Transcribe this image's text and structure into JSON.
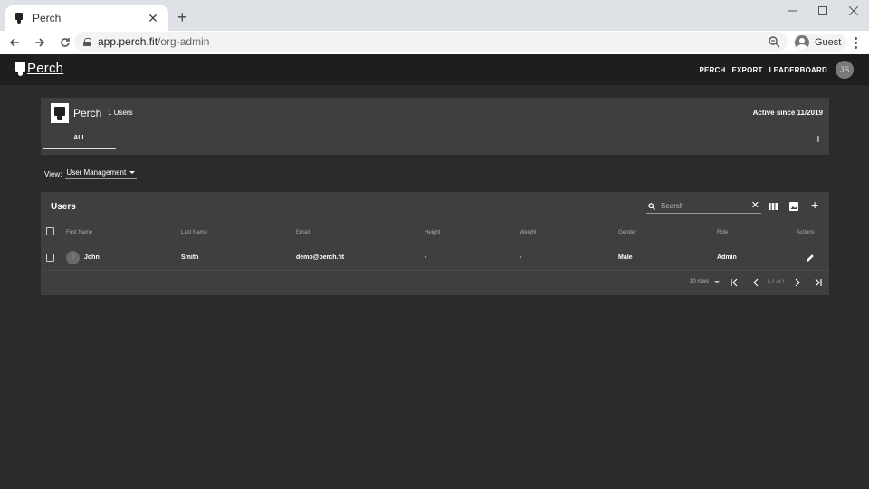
{
  "browser": {
    "tab_title": "Perch",
    "tab_close": "✕",
    "new_tab": "+",
    "url_host": "app.perch.fit",
    "url_path": "/org-admin",
    "profile_label": "Guest"
  },
  "appbar": {
    "logo_text": "Perch",
    "nav": [
      "PERCH",
      "EXPORT",
      "LEADERBOARD"
    ],
    "avatar_initials": "JS"
  },
  "org": {
    "name": "Perch",
    "user_count": "1 Users",
    "active_since": "Active since 11/2019",
    "tab_label": "ALL",
    "add_symbol": "+"
  },
  "view": {
    "label": "View:",
    "value": "User Management"
  },
  "users": {
    "title": "Users",
    "search_placeholder": "Search",
    "clear_symbol": "✕",
    "add_symbol": "+",
    "columns": [
      "First Name",
      "Last Name",
      "Email",
      "Height",
      "Weight",
      "Gender",
      "Role",
      "Actions"
    ],
    "rows": [
      {
        "avatar_initial": "J",
        "first_name": "John",
        "last_name": "Smith",
        "email": "demo@perch.fit",
        "height": "-",
        "weight": "-",
        "gender": "Male",
        "role": "Admin"
      }
    ],
    "pagination": {
      "rows_per_page": "10 rows",
      "range": "1-1 of 1"
    }
  },
  "colors": {
    "page_bg": "#2b2b2b",
    "card_bg": "#3f3f3f",
    "appbar_bg": "#1e1e1e"
  }
}
